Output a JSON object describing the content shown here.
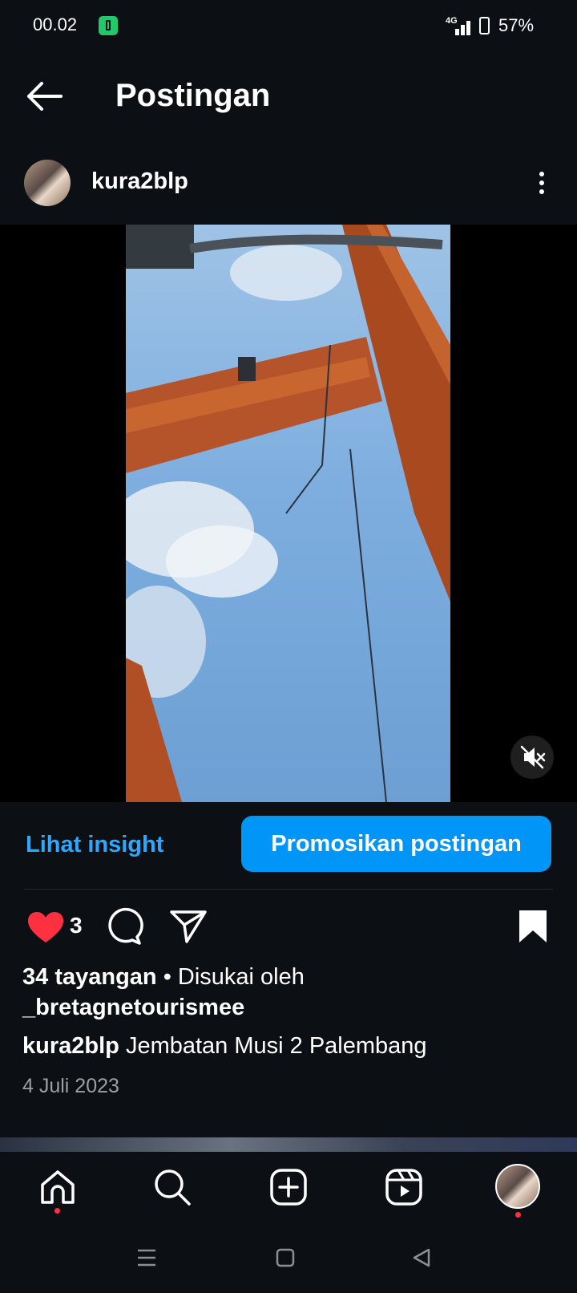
{
  "status_bar": {
    "time": "00.02",
    "network": "4G",
    "battery": "57%"
  },
  "header": {
    "title": "Postingan"
  },
  "post": {
    "username": "kura2blp",
    "actions": {
      "insight_label": "Lihat insight",
      "promote_label": "Promosikan postingan"
    },
    "likes_count": "3",
    "views": "34 tayangan",
    "liked_by_prefix": "• Disukai oleh",
    "liked_by_user": "_bretagnetourismee",
    "caption_user": "kura2blp",
    "caption_text": "Jembatan Musi 2 Palembang",
    "date": "4 Juli 2023"
  },
  "icons": {
    "back": "arrow-left-icon",
    "more": "more-vertical-icon",
    "mute": "volume-off-icon",
    "like": "heart-filled-icon",
    "comment": "comment-icon",
    "share": "send-icon",
    "save": "bookmark-filled-icon"
  },
  "nav": [
    "home",
    "search",
    "create",
    "reels",
    "profile"
  ],
  "colors": {
    "accent": "#0095f6",
    "link": "#2ca8ff",
    "like": "#ff3040",
    "background": "#0c0f14"
  }
}
